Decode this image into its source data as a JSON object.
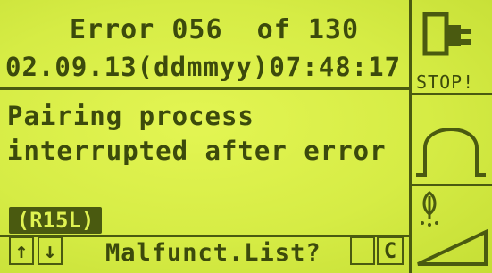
{
  "header": {
    "error_line": "Error 056  of 130",
    "datetime_line": "02.09.13(ddmmyy)07:48:17"
  },
  "message": {
    "line1": "Pairing process",
    "line2": "interrupted after error"
  },
  "code_badge": "(R15L)",
  "footer": {
    "up_arrow": "↑",
    "down_arrow": "↓",
    "prompt": "Malfunct.List?",
    "c_key": "C"
  },
  "side": {
    "stop_label": "STOP!"
  },
  "icons": [
    "stop-plug-icon",
    "bell-curve-icon",
    "plant-icon",
    "ramp-icon"
  ],
  "colors": {
    "lcd_background": "#d9ee4a",
    "lcd_foreground": "#4a5a10"
  }
}
